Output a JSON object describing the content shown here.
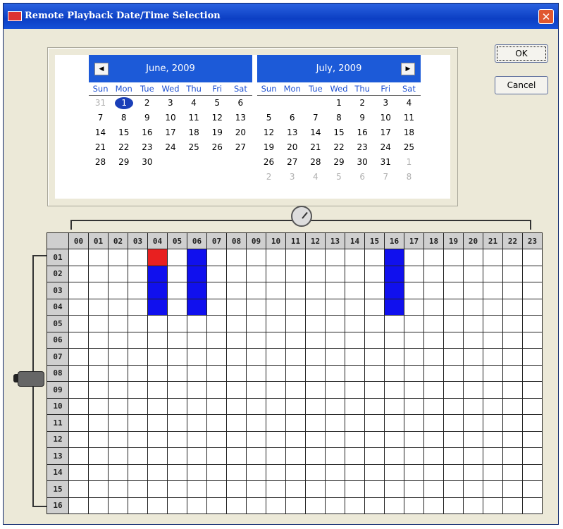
{
  "window": {
    "title": "Remote Playback Date/Time Selection",
    "close_symbol": "✕"
  },
  "buttons": {
    "ok": "OK",
    "cancel": "Cancel"
  },
  "calendar": {
    "prev_symbol": "◀",
    "next_symbol": "▶",
    "day_names": [
      "Sun",
      "Mon",
      "Tue",
      "Wed",
      "Thu",
      "Fri",
      "Sat"
    ],
    "months": [
      {
        "title": "June, 2009",
        "days": [
          {
            "d": "31",
            "other": true
          },
          {
            "d": "1",
            "sel": true
          },
          {
            "d": "2"
          },
          {
            "d": "3"
          },
          {
            "d": "4"
          },
          {
            "d": "5"
          },
          {
            "d": "6"
          },
          {
            "d": "7"
          },
          {
            "d": "8"
          },
          {
            "d": "9"
          },
          {
            "d": "10"
          },
          {
            "d": "11"
          },
          {
            "d": "12"
          },
          {
            "d": "13"
          },
          {
            "d": "14"
          },
          {
            "d": "15"
          },
          {
            "d": "16"
          },
          {
            "d": "17"
          },
          {
            "d": "18"
          },
          {
            "d": "19"
          },
          {
            "d": "20"
          },
          {
            "d": "21"
          },
          {
            "d": "22"
          },
          {
            "d": "23"
          },
          {
            "d": "24"
          },
          {
            "d": "25"
          },
          {
            "d": "26"
          },
          {
            "d": "27"
          },
          {
            "d": "28"
          },
          {
            "d": "29"
          },
          {
            "d": "30"
          }
        ]
      },
      {
        "title": "July, 2009",
        "days": [
          {
            "d": ""
          },
          {
            "d": ""
          },
          {
            "d": ""
          },
          {
            "d": "1"
          },
          {
            "d": "2"
          },
          {
            "d": "3"
          },
          {
            "d": "4"
          },
          {
            "d": "5"
          },
          {
            "d": "6"
          },
          {
            "d": "7"
          },
          {
            "d": "8"
          },
          {
            "d": "9"
          },
          {
            "d": "10"
          },
          {
            "d": "11"
          },
          {
            "d": "12"
          },
          {
            "d": "13"
          },
          {
            "d": "14"
          },
          {
            "d": "15"
          },
          {
            "d": "16"
          },
          {
            "d": "17"
          },
          {
            "d": "18"
          },
          {
            "d": "19"
          },
          {
            "d": "20"
          },
          {
            "d": "21"
          },
          {
            "d": "22"
          },
          {
            "d": "23"
          },
          {
            "d": "24"
          },
          {
            "d": "25"
          },
          {
            "d": "26"
          },
          {
            "d": "27"
          },
          {
            "d": "28"
          },
          {
            "d": "29"
          },
          {
            "d": "30"
          },
          {
            "d": "31"
          },
          {
            "d": "1",
            "other": true
          },
          {
            "d": "2",
            "other": true
          },
          {
            "d": "3",
            "other": true
          },
          {
            "d": "4",
            "other": true
          },
          {
            "d": "5",
            "other": true
          },
          {
            "d": "6",
            "other": true
          },
          {
            "d": "7",
            "other": true
          },
          {
            "d": "8",
            "other": true
          }
        ]
      }
    ]
  },
  "schedule": {
    "hours": [
      "00",
      "01",
      "02",
      "03",
      "04",
      "05",
      "06",
      "07",
      "08",
      "09",
      "10",
      "11",
      "12",
      "13",
      "14",
      "15",
      "16",
      "17",
      "18",
      "19",
      "20",
      "21",
      "22",
      "23"
    ],
    "channels": [
      "01",
      "02",
      "03",
      "04",
      "05",
      "06",
      "07",
      "08",
      "09",
      "10",
      "11",
      "12",
      "13",
      "14",
      "15",
      "16"
    ],
    "marked_cells": [
      {
        "channel": "01",
        "hour": "04",
        "color": "red"
      },
      {
        "channel": "02",
        "hour": "04",
        "color": "blue"
      },
      {
        "channel": "03",
        "hour": "04",
        "color": "blue"
      },
      {
        "channel": "04",
        "hour": "04",
        "color": "blue"
      },
      {
        "channel": "01",
        "hour": "06",
        "color": "blue"
      },
      {
        "channel": "02",
        "hour": "06",
        "color": "blue"
      },
      {
        "channel": "03",
        "hour": "06",
        "color": "blue"
      },
      {
        "channel": "04",
        "hour": "06",
        "color": "blue"
      },
      {
        "channel": "01",
        "hour": "16",
        "color": "blue"
      },
      {
        "channel": "02",
        "hour": "16",
        "color": "blue"
      },
      {
        "channel": "03",
        "hour": "16",
        "color": "blue"
      },
      {
        "channel": "04",
        "hour": "16",
        "color": "blue"
      }
    ],
    "colors": {
      "red": "#e82020",
      "blue": "#1010ee"
    }
  },
  "icons": {
    "title": "app-icon",
    "clock": "clock-icon",
    "camera": "camera-icon"
  }
}
